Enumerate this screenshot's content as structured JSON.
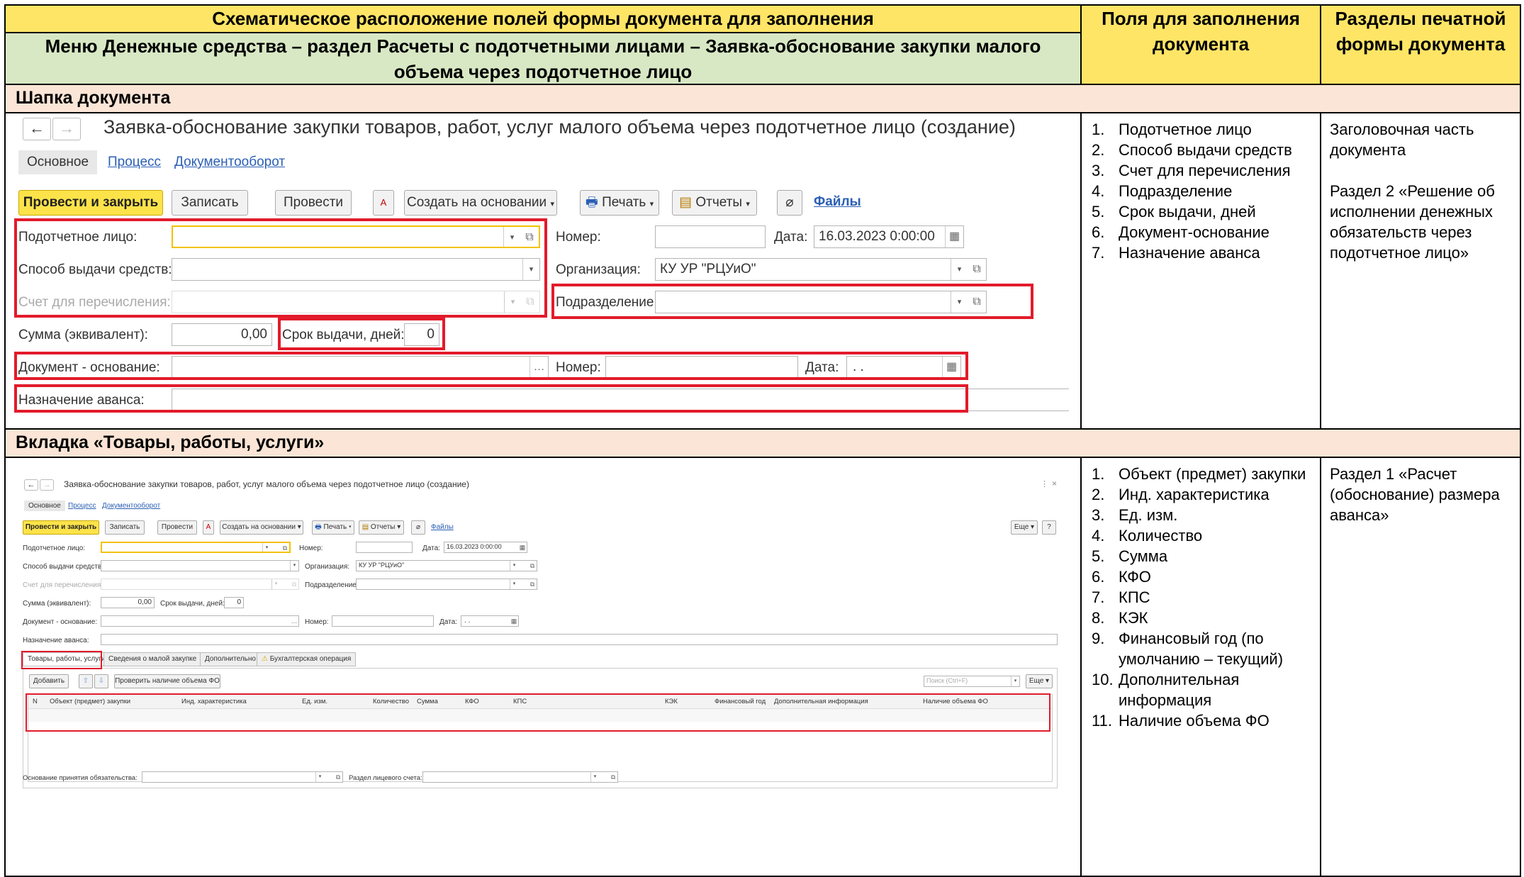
{
  "header": {
    "title": "Схематическое расположение полей формы документа для заполнения",
    "menu_path_line1": "Меню Денежные средства – раздел Расчеты с подотчетными лицами – Заявка-обоснование закупки малого",
    "menu_path_line2": "объема через подотчетное лицо",
    "col_fields_line1": "Поля для заполнения",
    "col_fields_line2": "документа",
    "col_sections_line1": "Разделы печатной",
    "col_sections_line2": "формы документа"
  },
  "section1": {
    "title": "Шапка документа",
    "fields": [
      {
        "n": "1.",
        "text": "Подотчетное лицо"
      },
      {
        "n": "2.",
        "text": "Способ выдачи средств"
      },
      {
        "n": "3.",
        "text": "Счет для перечисления"
      },
      {
        "n": "4.",
        "text": "Подразделение"
      },
      {
        "n": "5.",
        "text": "Срок выдачи, дней"
      },
      {
        "n": "6.",
        "text": "Документ-основание"
      },
      {
        "n": "7.",
        "text": "Назначение аванса"
      }
    ],
    "print_sections": {
      "p1": "Заголовочная часть документа",
      "p2": "Раздел 2 «Решение об исполнении денежных обязательств через подотчетное лицо»"
    }
  },
  "section2": {
    "title": "Вкладка «Товары, работы, услуги»",
    "fields": [
      {
        "n": "1.",
        "text": "Объект (предмет) закупки"
      },
      {
        "n": "2.",
        "text": "Инд. характеристика"
      },
      {
        "n": "3.",
        "text": "Ед. изм."
      },
      {
        "n": "4.",
        "text": "Количество"
      },
      {
        "n": "5.",
        "text": "Сумма"
      },
      {
        "n": "6.",
        "text": "КФО"
      },
      {
        "n": "7.",
        "text": "КПС"
      },
      {
        "n": "8.",
        "text": "КЭК"
      },
      {
        "n": "9.",
        "text": "Финансовый год (по умолчанию – текущий)"
      },
      {
        "n": "10.",
        "text": "Дополнительная информация"
      },
      {
        "n": "11.",
        "text": "Наличие объема ФО"
      }
    ],
    "print_sections": {
      "p1": "Раздел 1 «Расчет (обоснование) размера аванса»"
    }
  },
  "form": {
    "title": "Заявка-обоснование закупки товаров, работ, услуг малого объема через подотчетное лицо (создание)",
    "nav_tabs": {
      "main": "Основное",
      "process": "Процесс",
      "docflow": "Документооборот"
    },
    "toolbar": {
      "post_close": "Провести и закрыть",
      "save": "Записать",
      "post": "Провести",
      "create_based": "Создать на основании",
      "print": "Печать",
      "reports": "Отчеты",
      "files": "Файлы",
      "more": "Еще",
      "help": "?"
    },
    "labels": {
      "accountable": "Подотчетное лицо:",
      "payment_method": "Способ выдачи средств:",
      "account": "Счет для перечисления:",
      "sum": "Сумма (эквивалент):",
      "term": "Срок выдачи, дней:",
      "basis_doc": "Документ - основание:",
      "purpose": "Назначение аванса:",
      "number": "Номер:",
      "date": "Дата:",
      "organization": "Организация:",
      "department": "Подразделение:"
    },
    "values": {
      "date": "16.03.2023  0:00:00",
      "organization": "КУ УР \"РЦУиО\"",
      "sum": "0,00",
      "term": "0",
      "basis_date": " .  ."
    },
    "tabs": {
      "goods": "Товары, работы, услуги",
      "small_purchase": "Сведения о малой закупке",
      "additional": "Дополнительно",
      "accounting": "Бухгалтерская операция"
    },
    "table_toolbar": {
      "add": "Добавить",
      "check": "Проверить наличие объема ФО",
      "search_placeholder": "Поиск (Ctrl+F)"
    },
    "columns": [
      "N",
      "Объект (предмет) закупки",
      "Инд. характеристика",
      "Ед. изм.",
      "Количество",
      "Сумма",
      "КФО",
      "КПС",
      "КЭК",
      "Финансовый год",
      "Дополнительная информация",
      "Наличие объема ФО"
    ],
    "footer": {
      "basis_label": "Основание принятия обязательства:",
      "section_label": "Раздел лицевого счета:"
    }
  },
  "colors": {
    "header_yellow": "#ffe566",
    "header_green": "#d8e8c4",
    "section_peach": "#fbe5d6",
    "highlight_red": "#e21b2b",
    "primary_button": "#fde34a"
  }
}
